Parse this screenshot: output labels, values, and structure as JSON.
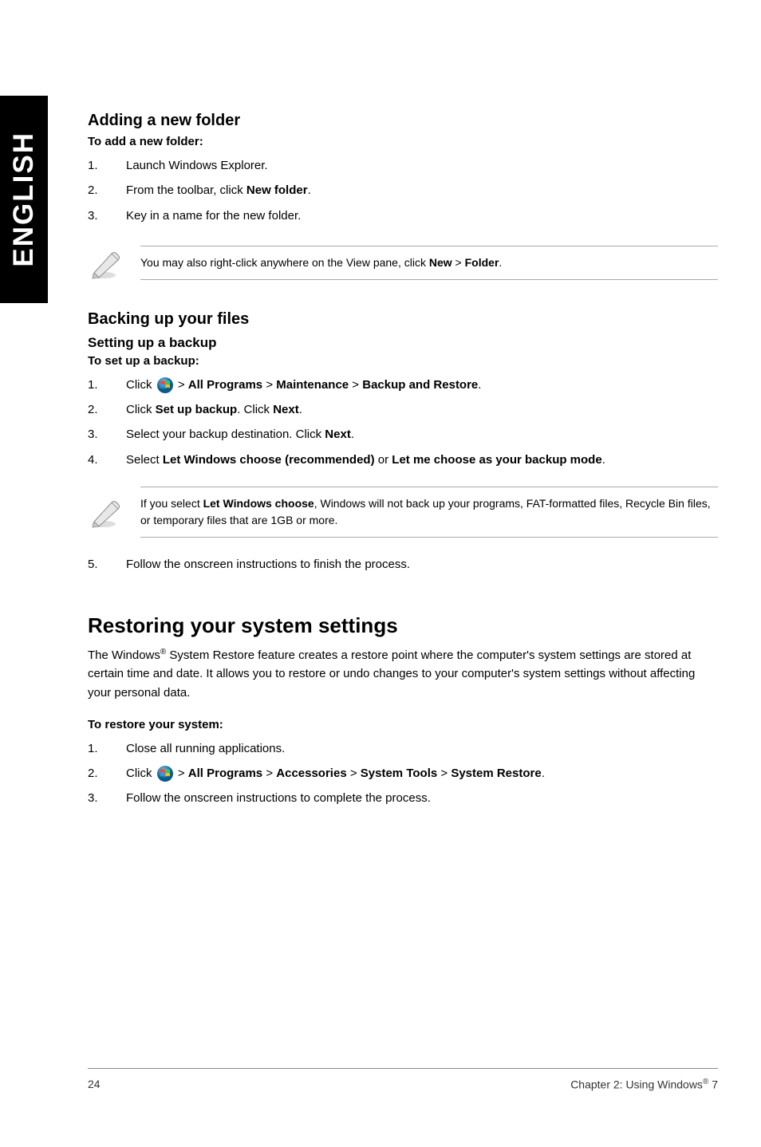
{
  "side_label": "ENGLISH",
  "section1": {
    "heading": "Adding a new folder",
    "subheading": "To add a new folder:",
    "steps": [
      "Launch Windows Explorer.",
      "From the toolbar, click <b>New folder</b>.",
      "Key in a name for the new folder."
    ],
    "note": "You may also right-click anywhere on the View pane, click <b>New</b> > <b>Folder</b>."
  },
  "section2": {
    "heading": "Backing up your files",
    "sub1": "Setting up a backup",
    "sub2": "To set up a backup:",
    "steps": [
      "Click {WIN} > <b>All Programs</b> > <b>Maintenance</b> > <b>Backup and Restore</b>.",
      "Click <b>Set up backup</b>. Click <b>Next</b>.",
      "Select your backup destination. Click <b>Next</b>.",
      "Select <b>Let Windows choose (recommended)</b> or <b>Let me choose as your backup mode</b>."
    ],
    "note": "If you select <b>Let Windows choose</b>, Windows will not back up your programs, FAT-formatted files, Recycle Bin files, or temporary files that are 1GB or more.",
    "step5": "Follow the onscreen instructions to finish the process."
  },
  "section3": {
    "heading": "Restoring your system settings",
    "para": "The Windows<span class=\"sup\">®</span> System Restore feature creates a restore point where the computer's system settings are stored at certain time and date. It allows you to restore or undo changes to your computer's system settings without affecting your personal data.",
    "sub": "To restore your system:",
    "steps": [
      "Close all running applications.",
      "Click {WIN} > <b>All Programs</b> > <b>Accessories</b> > <b>System Tools</b> > <b>System Restore</b>.",
      "Follow the onscreen instructions to complete the process."
    ]
  },
  "footer": {
    "page": "24",
    "chapter": "Chapter 2: Using Windows<span class=\"sup\">®</span> 7"
  },
  "icons": {
    "pen_svg": "<svg viewBox='0 0 46 46' width='46' height='46'><ellipse cx='20' cy='41' rx='15' ry='4' fill='#ddd'/><path d='M8 38 L30 14 Q33 11 36 14 L38 16 Q41 19 38 22 L14 44 Z' fill='#e8e8e8' stroke='#888' stroke-width='1'/><path d='M8 38 L14 44 L6 45 Z' fill='#ccc' stroke='#888' stroke-width='0.8'/><path d='M30 14 L38 22' stroke='#999' stroke-width='1'/></svg>",
    "win_svg": "<svg viewBox='0 0 20 20' width='20' height='20'><circle cx='10' cy='10' r='10' fill='url(#g1)'/><defs><radialGradient id='g1' cx='0.4' cy='0.3'><stop offset='0' stop-color='#7ec6e8'/><stop offset='1' stop-color='#0a5a8a'/></radialGradient></defs><g transform='translate(4,4)'><path d='M0 1 Q3 -0.5 6 1 L6 5 Q3 3.5 0 5 Z' fill='#e74c3c'/><path d='M6.5 1 Q9.5 -0.5 12 1 L12 5 Q9.5 3.5 6.5 5 Z' fill='#2ecc71'/><path d='M0 5.5 Q3 4 6 5.5 L6 9.5 Q3 8 0 9.5 Z' fill='#3498db'/><path d='M6.5 5.5 Q9.5 4 12 5.5 L12 9.5 Q9.5 8 6.5 9.5 Z' fill='#f1c40f'/></g></svg>"
  }
}
